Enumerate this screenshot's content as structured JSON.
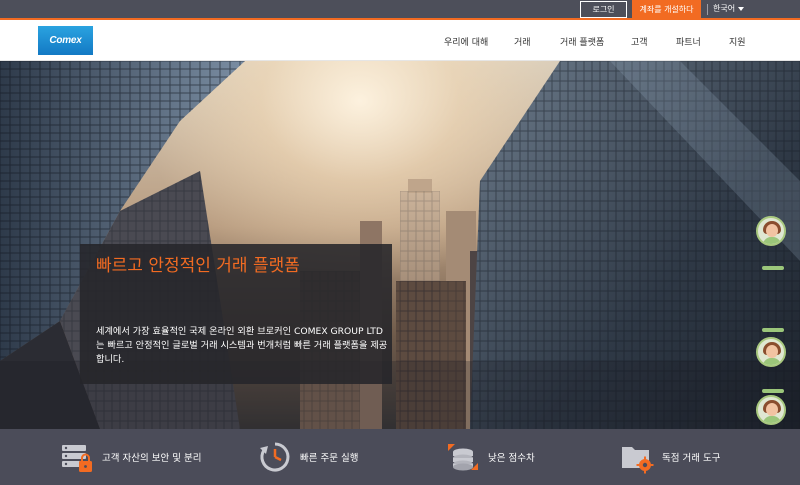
{
  "topbar": {
    "login_label": "로그인",
    "open_account_label": "계좌를 개설하다",
    "language_label": "한국어"
  },
  "nav": {
    "logo_text": "Comex",
    "items": [
      {
        "label": "우리에 대해"
      },
      {
        "label": "거래"
      },
      {
        "label": "거래 플랫폼"
      },
      {
        "label": "고객"
      },
      {
        "label": "파트너"
      },
      {
        "label": "지원"
      }
    ]
  },
  "hero": {
    "title": "빠르고 안정적인 거래 플랫폼",
    "description": "세계에서 가장 효율적인 국제 온라인 외환 브로커인 COMEX GROUP LTD는 빠르고 안정적인 글로벌 거래 시스템과 번개처럼 빠른 거래 플랫폼을 제공합니다."
  },
  "features": [
    {
      "label": "고객 자산의 보안 및 분리",
      "icon": "server-lock-icon"
    },
    {
      "label": "빠른 주문 실행",
      "icon": "clock-arrow-icon"
    },
    {
      "label": "낮은 점수차",
      "icon": "coins-arrows-icon"
    },
    {
      "label": "독점 거래 도구",
      "icon": "folder-gear-icon"
    }
  ],
  "colors": {
    "accent": "#f26b22",
    "topbar": "#4d4f5a",
    "feature_bar": "#4b4c59",
    "logo_blue": "#1f8fd6"
  }
}
